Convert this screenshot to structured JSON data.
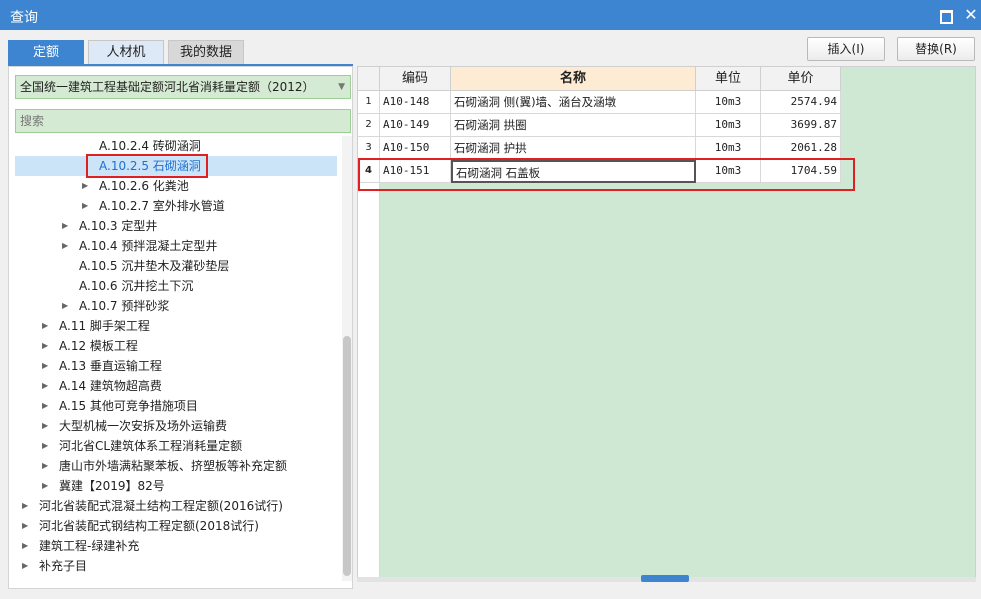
{
  "window": {
    "title": "查询",
    "maximize_icon": "maximize-icon",
    "close_icon": "close-icon",
    "close_glyph": "✕"
  },
  "tabs": [
    {
      "label": "定额",
      "active": true
    },
    {
      "label": "人材机",
      "active": false
    },
    {
      "label": "我的数据",
      "active": false
    }
  ],
  "actions": {
    "insert": "插入(I)",
    "replace": "替换(R)"
  },
  "library": {
    "value": "全国统一建筑工程基础定额河北省消耗量定额（2012）",
    "caret": "▼"
  },
  "search": {
    "placeholder": "搜索"
  },
  "tree": [
    {
      "label": "A.10.2.4 砖砌涵洞",
      "arrow": ""
    },
    {
      "label": "A.10.2.5 石砌涵洞",
      "arrow": "",
      "selected": true
    },
    {
      "label": "A.10.2.6 化粪池",
      "arrow": "▶"
    },
    {
      "label": "A.10.2.7 室外排水管道",
      "arrow": "▶"
    },
    {
      "label": "A.10.3 定型井",
      "arrow": "▶"
    },
    {
      "label": "A.10.4 预拌混凝土定型井",
      "arrow": "▶"
    },
    {
      "label": "A.10.5 沉井垫木及灌砂垫层",
      "arrow": ""
    },
    {
      "label": "A.10.6 沉井挖土下沉",
      "arrow": ""
    },
    {
      "label": "A.10.7 预拌砂浆",
      "arrow": "▶"
    },
    {
      "label": "A.11 脚手架工程",
      "arrow": "▶"
    },
    {
      "label": "A.12 模板工程",
      "arrow": "▶"
    },
    {
      "label": "A.13 垂直运输工程",
      "arrow": "▶"
    },
    {
      "label": "A.14 建筑物超高费",
      "arrow": "▶"
    },
    {
      "label": "A.15 其他可竞争措施项目",
      "arrow": "▶"
    },
    {
      "label": "大型机械一次安拆及场外运输费",
      "arrow": "▶"
    },
    {
      "label": "河北省CL建筑体系工程消耗量定额",
      "arrow": "▶"
    },
    {
      "label": "唐山市外墙满粘聚苯板、挤塑板等补充定额",
      "arrow": "▶"
    },
    {
      "label": "冀建【2019】82号",
      "arrow": "▶"
    },
    {
      "label": "河北省装配式混凝土结构工程定额(2016试行)",
      "arrow": "▶"
    },
    {
      "label": "河北省装配式钢结构工程定额(2018试行)",
      "arrow": "▶"
    },
    {
      "label": "建筑工程-绿建补充",
      "arrow": "▶"
    },
    {
      "label": "补充子目",
      "arrow": "▶"
    }
  ],
  "grid": {
    "headers": [
      "编码",
      "名称",
      "单位",
      "单价"
    ],
    "rows": [
      {
        "num": "1",
        "code": "A10-148",
        "name": "石砌涵洞 侧(翼)墙、涵台及涵墩",
        "unit": "10m3",
        "price": "2574.94"
      },
      {
        "num": "2",
        "code": "A10-149",
        "name": "石砌涵洞 拱圈",
        "unit": "10m3",
        "price": "3699.87"
      },
      {
        "num": "3",
        "code": "A10-150",
        "name": "石砌涵洞 护拱",
        "unit": "10m3",
        "price": "2061.28"
      },
      {
        "num": "4",
        "code": "A10-151",
        "name": "石砌涵洞 石盖板",
        "unit": "10m3",
        "price": "1704.59"
      }
    ]
  }
}
